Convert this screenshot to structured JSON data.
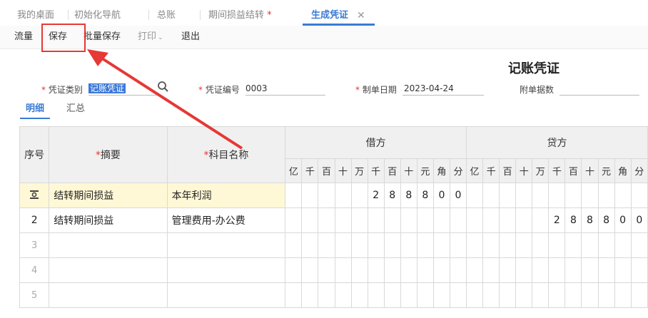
{
  "tabs": [
    {
      "label": "我的桌面"
    },
    {
      "label": "初始化导航"
    },
    {
      "label": "总账"
    },
    {
      "label": "期间损益结转",
      "modified": "*"
    },
    {
      "label": "生成凭证",
      "active": true
    }
  ],
  "toolbar": {
    "flow_label": "流量",
    "save_label": "保存",
    "batch_save_label": "批量保存",
    "print_label": "打印",
    "exit_label": "退出"
  },
  "voucher": {
    "title": "记账凭证",
    "type_label": "凭证类别",
    "type_value": "记账凭证",
    "number_label": "凭证编号",
    "number_value": "0003",
    "date_label": "制单日期",
    "date_value": "2023-04-24",
    "attach_label": "附单据数",
    "attach_value": ""
  },
  "subtabs": {
    "detail": "明细",
    "summary": "汇总"
  },
  "table": {
    "col_index": "序号",
    "col_summary": "摘要",
    "col_account": "科目名称",
    "col_debit": "借方",
    "col_credit": "贷方",
    "digit_units": [
      "亿",
      "千",
      "百",
      "十",
      "万",
      "千",
      "百",
      "十",
      "元",
      "角",
      "分"
    ],
    "rows": [
      {
        "index": "",
        "summary": "结转期间损益",
        "account": "本年利润",
        "debit": [
          "",
          "",
          "",
          "",
          "",
          "2",
          "8",
          "8",
          "8",
          "0",
          "0"
        ],
        "credit": [
          "",
          "",
          "",
          "",
          "",
          "",
          "",
          "",
          "",
          "",
          ""
        ]
      },
      {
        "index": "2",
        "summary": "结转期间损益",
        "account": "管理费用-办公费",
        "debit": [
          "",
          "",
          "",
          "",
          "",
          "",
          "",
          "",
          "",
          "",
          ""
        ],
        "credit": [
          "",
          "",
          "",
          "",
          "",
          "2",
          "8",
          "8",
          "8",
          "0",
          "0"
        ]
      },
      {
        "index": "3",
        "summary": "",
        "account": "",
        "debit": [],
        "credit": []
      },
      {
        "index": "4",
        "summary": "",
        "account": "",
        "debit": [],
        "credit": []
      },
      {
        "index": "5",
        "summary": "",
        "account": "",
        "debit": [],
        "credit": []
      }
    ]
  },
  "accent_color": "#3a7bd5",
  "highlight_color": "#e53935"
}
